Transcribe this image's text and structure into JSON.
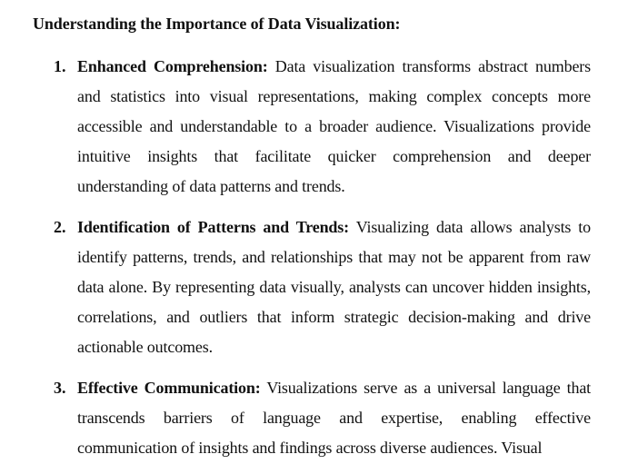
{
  "document": {
    "heading": "Understanding the Importance of Data Visualization:",
    "items": [
      {
        "number": "1.",
        "term": "Enhanced Comprehension:",
        "text": "Data visualization transforms abstract numbers and statistics into visual representations, making complex concepts more accessible and understandable to a broader audience. Visualizations provide intuitive insights that facilitate quicker comprehension and deeper understanding of data patterns and trends."
      },
      {
        "number": "2.",
        "term": "Identification of Patterns and Trends:",
        "text": "Visualizing data allows analysts to identify patterns, trends, and relationships that may not be apparent from raw data alone. By representing data visually, analysts can uncover hidden insights, correlations, and outliers that inform strategic decision-making and drive actionable outcomes."
      },
      {
        "number": "3.",
        "term": "Effective Communication:",
        "text": "Visualizations serve as a universal language that transcends barriers of language and expertise, enabling effective communication of insights and findings across diverse audiences. Visual"
      }
    ]
  }
}
